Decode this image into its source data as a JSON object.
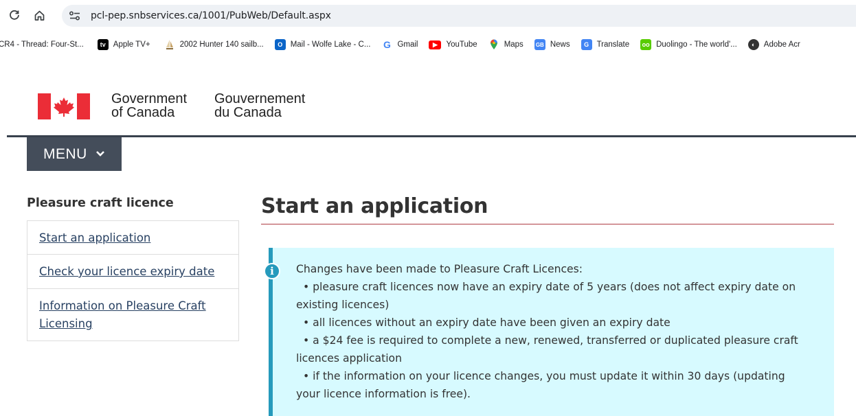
{
  "browser": {
    "url": "pcl-pep.snbservices.ca/1001/PubWeb/Default.aspx",
    "bookmarks": [
      {
        "label": "CR4 - Thread: Four-St...",
        "icon": "none"
      },
      {
        "label": "Apple TV+",
        "icon": "appletv-icon",
        "color": "#000000"
      },
      {
        "label": "2002 Hunter 140 sailb...",
        "icon": "sailboat-icon",
        "color": "#c8a46a"
      },
      {
        "label": "Mail - Wolfe Lake - C...",
        "icon": "outlook-icon",
        "color": "#0a64c8"
      },
      {
        "label": "Gmail",
        "icon": "google-icon",
        "color": "#4285f4"
      },
      {
        "label": "YouTube",
        "icon": "youtube-icon",
        "color": "#ff0000"
      },
      {
        "label": "Maps",
        "icon": "maps-icon",
        "color": "#34a853"
      },
      {
        "label": "News",
        "icon": "news-icon",
        "color": "#4285f4"
      },
      {
        "label": "Translate",
        "icon": "translate-icon",
        "color": "#4285f4"
      },
      {
        "label": "Duolingo - The world'...",
        "icon": "duolingo-icon",
        "color": "#58cc02"
      },
      {
        "label": "Adobe Acr",
        "icon": "globe-icon",
        "color": "#333333"
      }
    ]
  },
  "header": {
    "signature_en_line1": "Government",
    "signature_en_line2": "of Canada",
    "signature_fr_line1": "Gouvernement",
    "signature_fr_line2": "du Canada",
    "menu_label": "MENU",
    "flag_color": "#eb2d37"
  },
  "section_nav": {
    "title": "Pleasure craft licence",
    "items": [
      {
        "label": "Start an application"
      },
      {
        "label": "Check your licence expiry date"
      },
      {
        "label_line1": "Information on Pleasure Craft",
        "label_line2": "Licensing"
      }
    ]
  },
  "main": {
    "title": "Start an application",
    "alert": {
      "intro": "Changes have been made to Pleasure Craft Licences:",
      "bullet1_line1": "• pleasure craft licences now have an expiry date of 5 years (does not affect expiry date on",
      "bullet1_line2": "existing licences)",
      "bullet2_line1": "• all licences without an expiry date have been given an expiry date",
      "bullet3_line1": "• a $24 fee is required to complete a new, renewed, transferred or duplicated pleasure craft",
      "bullet3_line2": "licences application",
      "bullet4_line1": "• if the information on your licence changes, you must update it within 30 days (updating",
      "bullet4_line2": "your licence information is free)."
    }
  }
}
